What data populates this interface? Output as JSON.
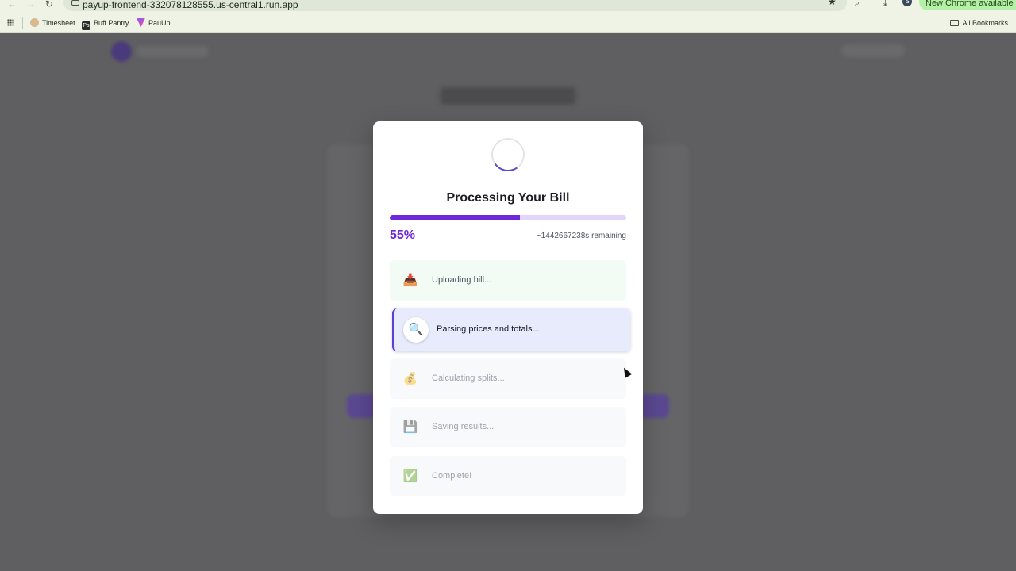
{
  "browser": {
    "url": "payup-frontend-332078128555.us-central1.run.app",
    "update_label": "New Chrome available",
    "profile_initial": "S",
    "bookmarks": [
      {
        "label": "Timesheet",
        "icon": "timesheet-favicon"
      },
      {
        "label": "Buff Pantry",
        "icon": "ps-favicon"
      },
      {
        "label": "PauUp",
        "icon": "payup-favicon"
      }
    ],
    "all_bookmarks_label": "All Bookmarks"
  },
  "modal": {
    "title": "Processing Your Bill",
    "progress_percent": 55,
    "progress_label": "55%",
    "remaining_label": "~1442667238s remaining",
    "accent_color": "#6d28d9",
    "steps": [
      {
        "label": "Uploading bill...",
        "icon": "inbox-tray-icon",
        "glyph": "📥",
        "state": "done"
      },
      {
        "label": "Parsing prices and totals...",
        "icon": "magnifier-icon",
        "glyph": "🔍",
        "state": "active"
      },
      {
        "label": "Calculating splits...",
        "icon": "money-bag-icon",
        "glyph": "💰",
        "state": "pending"
      },
      {
        "label": "Saving results...",
        "icon": "floppy-disk-icon",
        "glyph": "💾",
        "state": "pending"
      },
      {
        "label": "Complete!",
        "icon": "check-mark-icon",
        "glyph": "✅",
        "state": "pending"
      }
    ]
  }
}
